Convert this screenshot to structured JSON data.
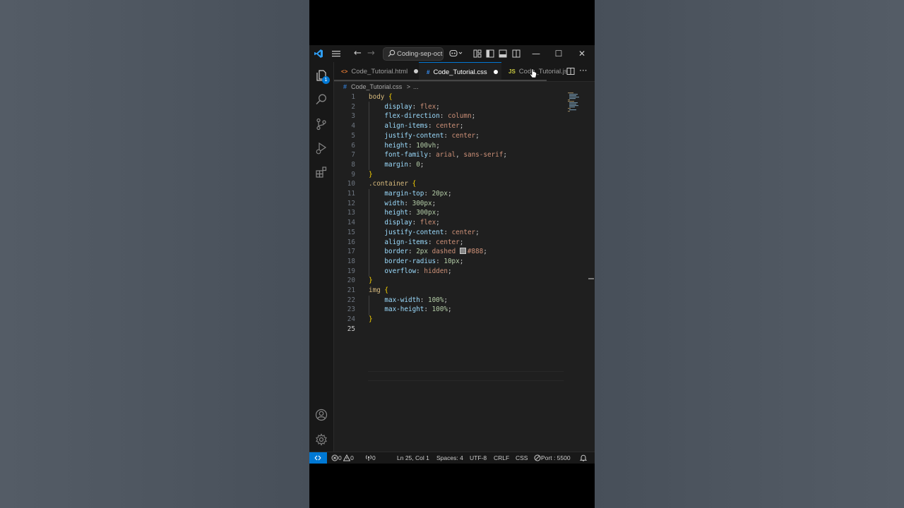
{
  "titlebar": {
    "search_text": "Coding-sep-oct",
    "back": "←",
    "forward": "→",
    "minimize": "—",
    "maximize": "☐",
    "close": "✕"
  },
  "activity": {
    "explorer_badge": "1"
  },
  "tabs": [
    {
      "label": "Code_Tutorial.html",
      "icon": "<>",
      "icon_color": "#e37933",
      "modified": true,
      "active": false
    },
    {
      "label": "Code_Tutorial.css",
      "icon": "#",
      "icon_color": "#3794ff",
      "modified": true,
      "active": true
    },
    {
      "label": "Code_Tutorial.js",
      "icon": "JS",
      "icon_color": "#cbcb41",
      "modified": false,
      "active": false
    }
  ],
  "tab_more": "···",
  "breadcrumb": {
    "icon": "#",
    "file": "Code_Tutorial.css",
    "sep": ">",
    "rest": "..."
  },
  "editor": {
    "lines": [
      {
        "n": "1"
      },
      {
        "n": "2"
      },
      {
        "n": "3"
      },
      {
        "n": "4"
      },
      {
        "n": "5"
      },
      {
        "n": "6"
      },
      {
        "n": "7"
      },
      {
        "n": "8"
      },
      {
        "n": "9"
      },
      {
        "n": "10"
      },
      {
        "n": "11"
      },
      {
        "n": "12"
      },
      {
        "n": "13"
      },
      {
        "n": "14"
      },
      {
        "n": "15"
      },
      {
        "n": "16"
      },
      {
        "n": "17"
      },
      {
        "n": "18"
      },
      {
        "n": "19"
      },
      {
        "n": "20"
      },
      {
        "n": "21"
      },
      {
        "n": "22"
      },
      {
        "n": "23"
      },
      {
        "n": "24"
      },
      {
        "n": "25"
      }
    ],
    "code": {
      "l1_sel": "body",
      "l1_brace": "{",
      "l2_prop": "display",
      "l2_val": "flex",
      "l3_prop": "flex-direction",
      "l3_val": "column",
      "l4_prop": "align-items",
      "l4_val": "center",
      "l5_prop": "justify-content",
      "l5_val": "center",
      "l6_prop": "height",
      "l6_val": "100vh",
      "l7_prop": "font-family",
      "l7_val1": "arial",
      "l7_val2": "sans-serif",
      "l8_prop": "margin",
      "l8_val": "0",
      "l9_brace": "}",
      "l10_sel": ".container",
      "l10_brace": "{",
      "l11_prop": "margin-top",
      "l11_val": "20px",
      "l12_prop": "width",
      "l12_val": "300px",
      "l13_prop": "height",
      "l13_val": "300px",
      "l14_prop": "display",
      "l14_val": "flex",
      "l15_prop": "justify-content",
      "l15_val": "center",
      "l16_prop": "align-items",
      "l16_val": "center",
      "l17_prop": "border",
      "l17_num": "2px",
      "l17_val": "dashed",
      "l17_color": "#888",
      "l18_prop": "border-radius",
      "l18_val": "10px",
      "l19_prop": "overflow",
      "l19_val": "hidden",
      "l20_brace": "}",
      "l21_sel": "img",
      "l21_brace": "{",
      "l22_prop": "max-width",
      "l22_val": "100%",
      "l23_prop": "max-height",
      "l23_val": "100%",
      "l24_brace": "}"
    }
  },
  "status": {
    "errors": "0",
    "warnings": "0",
    "ports": "0",
    "position": "Ln 25, Col 1",
    "spaces": "Spaces: 4",
    "encoding": "UTF-8",
    "eol": "CRLF",
    "language": "CSS",
    "port": "Port : 5500"
  },
  "colors": {
    "accent": "#0078d4",
    "background": "#1f1f1f",
    "chrome": "#181818"
  }
}
